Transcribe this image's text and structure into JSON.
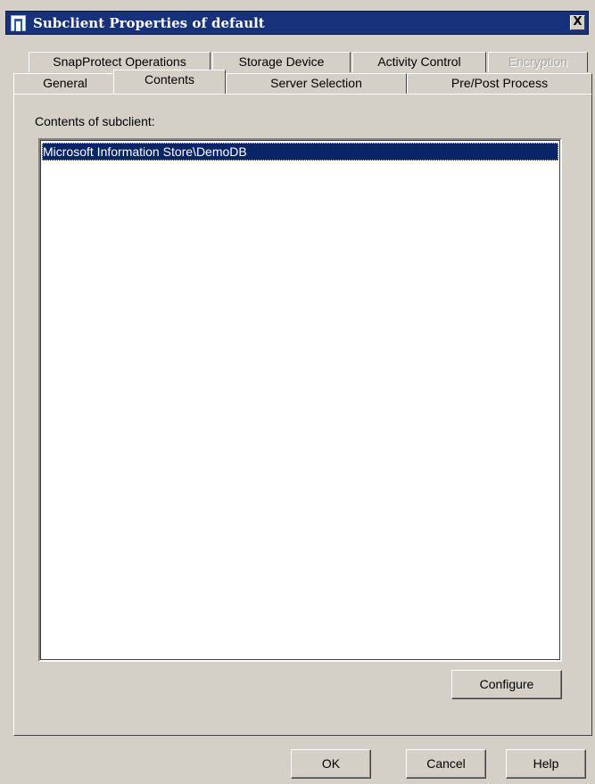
{
  "window": {
    "title": "Subclient Properties of default",
    "close_label": "X"
  },
  "tabs": {
    "row1": [
      {
        "label": "SnapProtect Operations",
        "enabled": true
      },
      {
        "label": "Storage Device",
        "enabled": true
      },
      {
        "label": "Activity Control",
        "enabled": true
      },
      {
        "label": "Encryption",
        "enabled": false
      }
    ],
    "row2": [
      {
        "label": "General",
        "enabled": true
      },
      {
        "label": "Contents",
        "enabled": true,
        "selected": true
      },
      {
        "label": "Server Selection",
        "enabled": true
      },
      {
        "label": "Pre/Post Process",
        "enabled": true
      }
    ]
  },
  "contents": {
    "label": "Contents of subclient:",
    "items": [
      "Microsoft Information Store\\DemoDB"
    ],
    "selected_index": 0,
    "configure_label": "Configure"
  },
  "footer": {
    "ok_label": "OK",
    "cancel_label": "Cancel",
    "help_label": "Help"
  },
  "colors": {
    "titlebar": "#17317a",
    "selection": "#0a246a",
    "face": "#d4d0c8"
  }
}
